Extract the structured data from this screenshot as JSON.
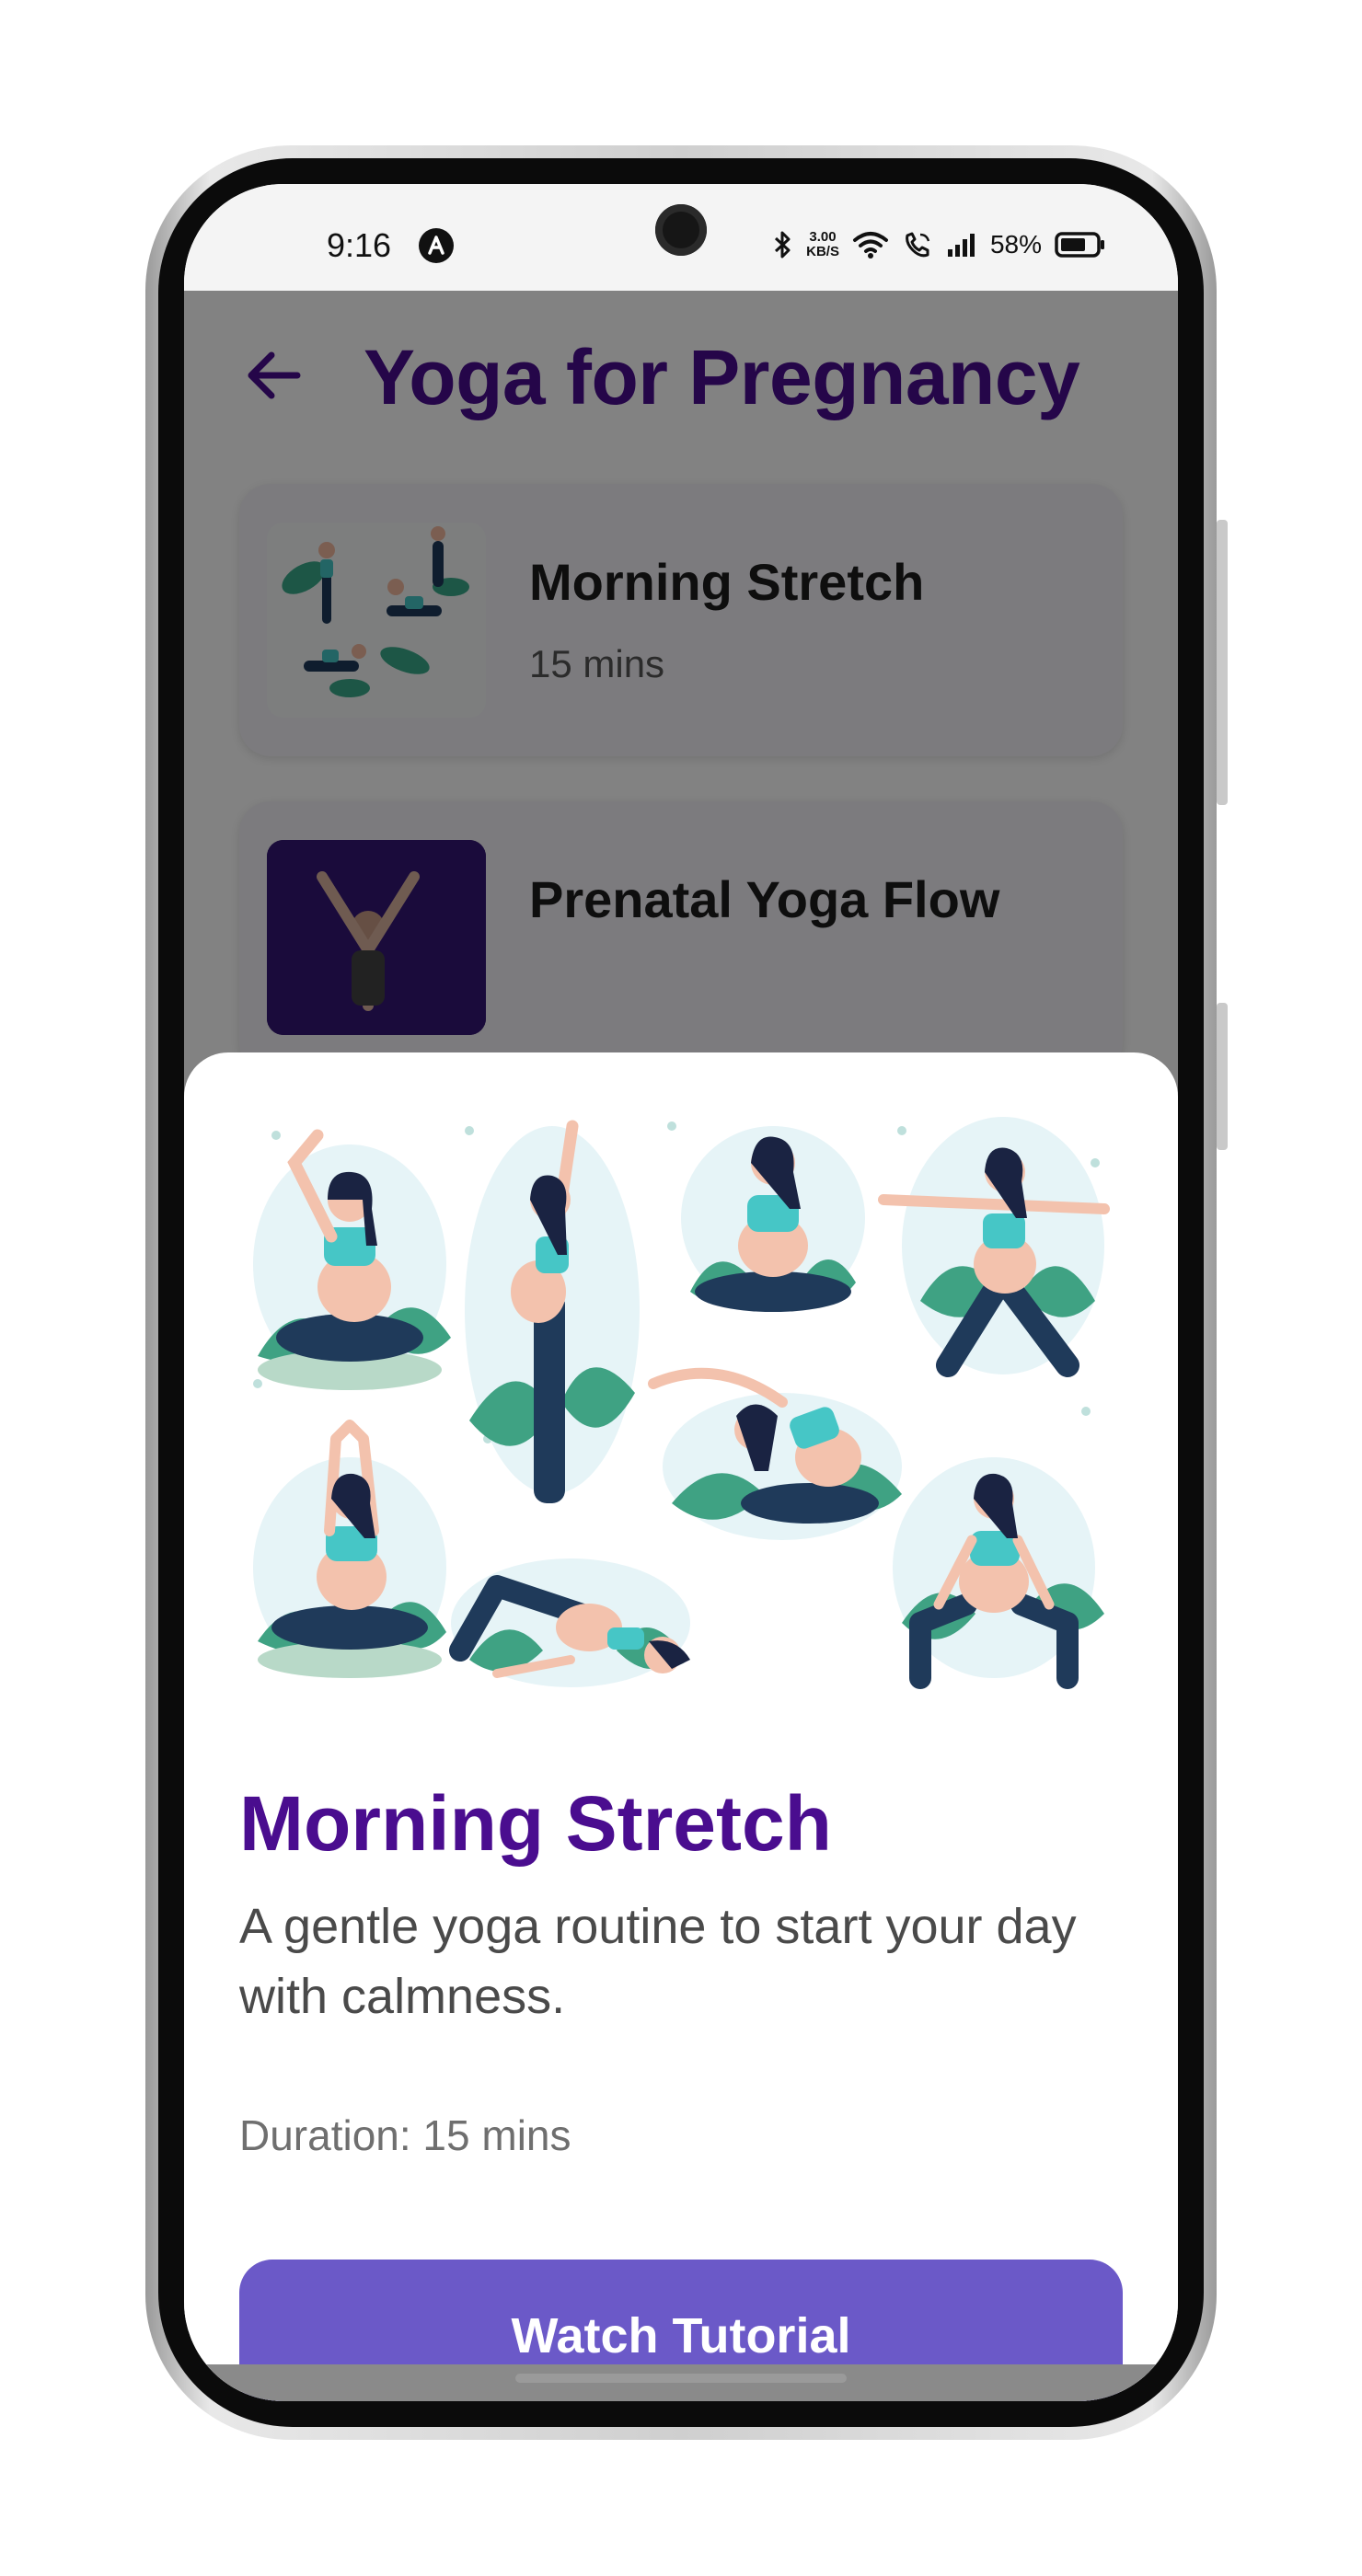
{
  "status_bar": {
    "time": "9:16",
    "net_speed_value": "3.00",
    "net_speed_unit": "KB/S",
    "battery": "58%",
    "icons": [
      "app-notification-icon",
      "bluetooth-icon",
      "wifi-icon",
      "wifi-call-icon",
      "signal-icon",
      "battery-icon"
    ]
  },
  "header": {
    "title": "Yoga for Pregnancy",
    "back_icon": "back-arrow-icon"
  },
  "sessions": [
    {
      "title": "Morning Stretch",
      "duration": "15 mins"
    },
    {
      "title": "Prenatal Yoga Flow",
      "duration": ""
    }
  ],
  "sheet": {
    "title": "Morning Stretch",
    "description": "A gentle yoga routine to start your day with calmness.",
    "duration_label": "Duration: 15 mins",
    "button_label": "Watch Tutorial"
  },
  "colors": {
    "accent_purple": "#4a0d8f",
    "button_purple": "#6b59c8",
    "teal": "#46c6c6",
    "navy": "#1f3a5a"
  }
}
